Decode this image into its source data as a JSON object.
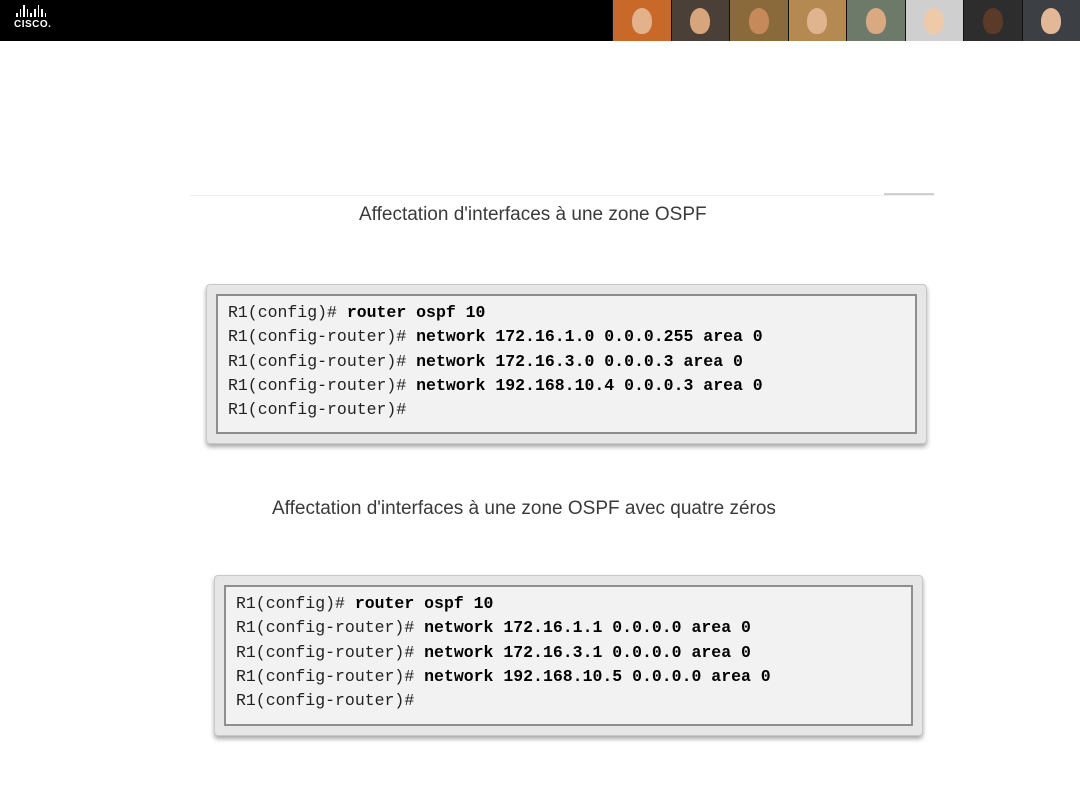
{
  "header": {
    "logo_text": "CISCO.",
    "photo_colors": [
      "#c8692a",
      "#4b4038",
      "#8a6a3a",
      "#b48a52",
      "#6d7a6a",
      "#cfcfcf",
      "#2d2d2d",
      "#3c3f44"
    ],
    "face_colors": [
      "#e3b28a",
      "#d7a57c",
      "#c68a5a",
      "#e0b48e",
      "#d9a982",
      "#efcaa8",
      "#5a3a28",
      "#e3b896"
    ]
  },
  "section1": {
    "title": "Affectation d'interfaces à une zone OSPF",
    "lines": [
      {
        "prompt": "R1(config)# ",
        "command": "router ospf 10"
      },
      {
        "prompt": "R1(config-router)# ",
        "command": "network 172.16.1.0 0.0.0.255 area 0"
      },
      {
        "prompt": "R1(config-router)# ",
        "command": "network 172.16.3.0 0.0.0.3 area 0"
      },
      {
        "prompt": "R1(config-router)# ",
        "command": "network 192.168.10.4 0.0.0.3 area 0"
      },
      {
        "prompt": "R1(config-router)#",
        "command": ""
      }
    ]
  },
  "section2": {
    "title": "Affectation d'interfaces à une zone OSPF avec quatre zéros",
    "lines": [
      {
        "prompt": "R1(config)# ",
        "command": "router ospf 10"
      },
      {
        "prompt": "R1(config-router)# ",
        "command": "network 172.16.1.1 0.0.0.0 area 0"
      },
      {
        "prompt": "R1(config-router)# ",
        "command": "network 172.16.3.1 0.0.0.0 area 0"
      },
      {
        "prompt": "R1(config-router)# ",
        "command": "network 192.168.10.5 0.0.0.0 area 0"
      },
      {
        "prompt": "R1(config-router)#",
        "command": ""
      }
    ]
  }
}
